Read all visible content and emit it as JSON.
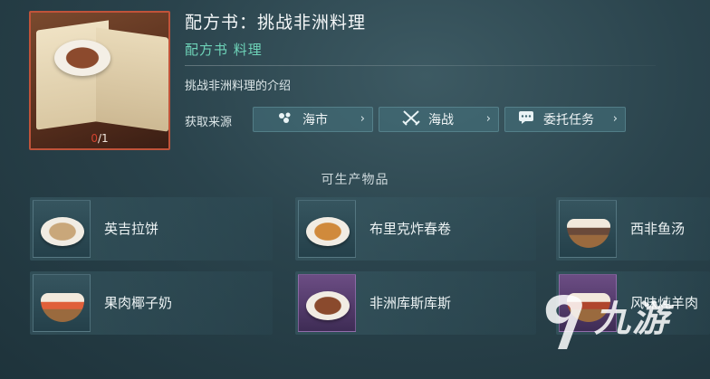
{
  "recipe": {
    "title": "配方书：挑战非洲料理",
    "subtitle": "配方书 料理",
    "intro": "挑战非洲料理的介绍",
    "owned": "0",
    "total": "/1",
    "source_label": "获取来源",
    "sources": [
      {
        "label": "海市",
        "icon": "market-icon"
      },
      {
        "label": "海战",
        "icon": "crossed-swords-icon"
      },
      {
        "label": "委托任务",
        "icon": "chat-bubble-icon"
      }
    ],
    "chevron": "›"
  },
  "products": {
    "heading": "可生产物品",
    "items": [
      {
        "name": "英吉拉饼",
        "food_color": "#c9a77a",
        "frame": "blue"
      },
      {
        "name": "布里克炸春卷",
        "food_color": "#d08a3c",
        "frame": "blue"
      },
      {
        "name": "西非鱼汤",
        "food_color": "#6a4a3a",
        "frame": "blue"
      },
      {
        "name": "果肉椰子奶",
        "food_color": "#e0603a",
        "frame": "blue"
      },
      {
        "name": "非洲库斯库斯",
        "food_color": "#8a4a2d",
        "frame": "purple"
      },
      {
        "name": "风味炖羊肉",
        "food_color": "#b0452c",
        "frame": "purple"
      }
    ]
  },
  "watermark": {
    "text": "九游"
  },
  "colors": {
    "accent": "#6ed3b8",
    "owned_zero": "#d1432f",
    "card_border": "#c0533a"
  }
}
